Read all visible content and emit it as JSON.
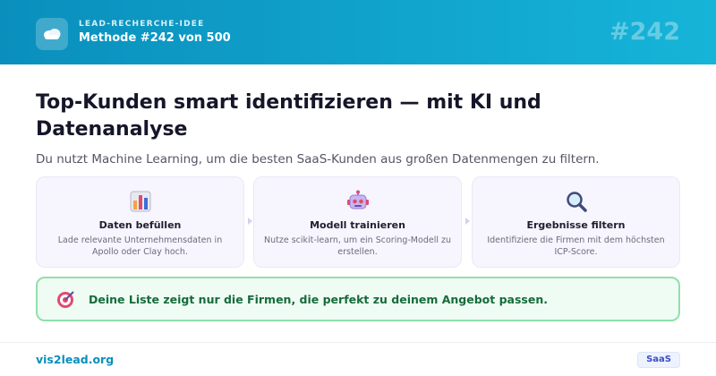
{
  "header": {
    "logo_icon": "cloud-icon",
    "overline": "LEAD-RECHERCHE-IDEE",
    "method": "Methode #242 von 500",
    "number": "#242"
  },
  "main": {
    "title": "Top-Kunden smart identifizieren — mit KI und Datenanalyse",
    "subtitle": "Du nutzt Machine Learning, um die besten SaaS-Kunden aus großen Datenmengen zu filtern.",
    "steps": [
      {
        "icon": "bar-chart-icon",
        "title": "Daten befüllen",
        "desc": "Lade relevante Unternehmensdaten in Apollo oder Clay hoch."
      },
      {
        "icon": "robot-icon",
        "title": "Modell trainieren",
        "desc": "Nutze scikit-learn, um ein Scoring-Modell zu erstellen."
      },
      {
        "icon": "magnifier-icon",
        "title": "Ergebnisse filtern",
        "desc": "Identifiziere die Firmen mit dem höchsten ICP-Score."
      }
    ],
    "callout": {
      "icon": "target-icon",
      "text": "Deine Liste zeigt nur die Firmen, die perfekt zu deinem Angebot passen."
    }
  },
  "footer": {
    "link": "vis2lead.org",
    "badge": "SaaS"
  },
  "colors": {
    "brand": "#0a8fbd",
    "callout_border": "#8fe0ab",
    "callout_text": "#166b3b",
    "badge_text": "#3b4fc4"
  }
}
